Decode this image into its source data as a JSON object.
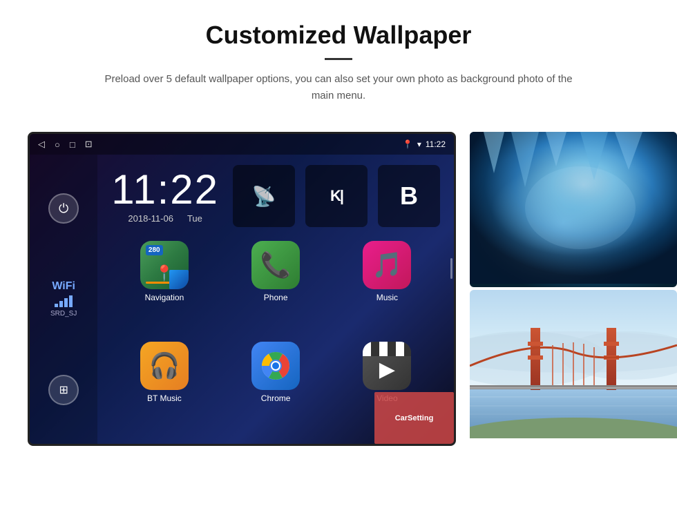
{
  "header": {
    "title": "Customized Wallpaper",
    "divider": "—",
    "description": "Preload over 5 default wallpaper options, you can also set your own photo as background photo of the main menu."
  },
  "device": {
    "status_bar": {
      "time": "11:22",
      "nav_back": "◁",
      "nav_home": "○",
      "nav_recent": "□",
      "nav_screenshot": "⊡",
      "location_icon": "📍",
      "wifi_icon": "▾",
      "time_display": "11:22"
    },
    "clock": {
      "time": "11:22",
      "date": "2018-11-06",
      "day": "Tue"
    },
    "sidebar": {
      "power_icon": "⏻",
      "wifi_label": "WiFi",
      "wifi_ssid": "SRD_SJ",
      "apps_icon": "⊞"
    },
    "apps": [
      {
        "name": "Navigation",
        "type": "navigation"
      },
      {
        "name": "Phone",
        "type": "phone"
      },
      {
        "name": "Music",
        "type": "music"
      },
      {
        "name": "BT Music",
        "type": "btmusic"
      },
      {
        "name": "Chrome",
        "type": "chrome"
      },
      {
        "name": "Video",
        "type": "video"
      }
    ],
    "widgets": [
      {
        "type": "antenna",
        "label": "📡"
      },
      {
        "type": "letter",
        "label": "K|"
      },
      {
        "type": "letter2",
        "label": "B"
      }
    ]
  },
  "wallpapers": [
    {
      "name": "Ice Cave",
      "type": "ice"
    },
    {
      "name": "Golden Gate Bridge",
      "type": "bridge"
    }
  ],
  "carsetting": {
    "label": "CarSetting"
  }
}
